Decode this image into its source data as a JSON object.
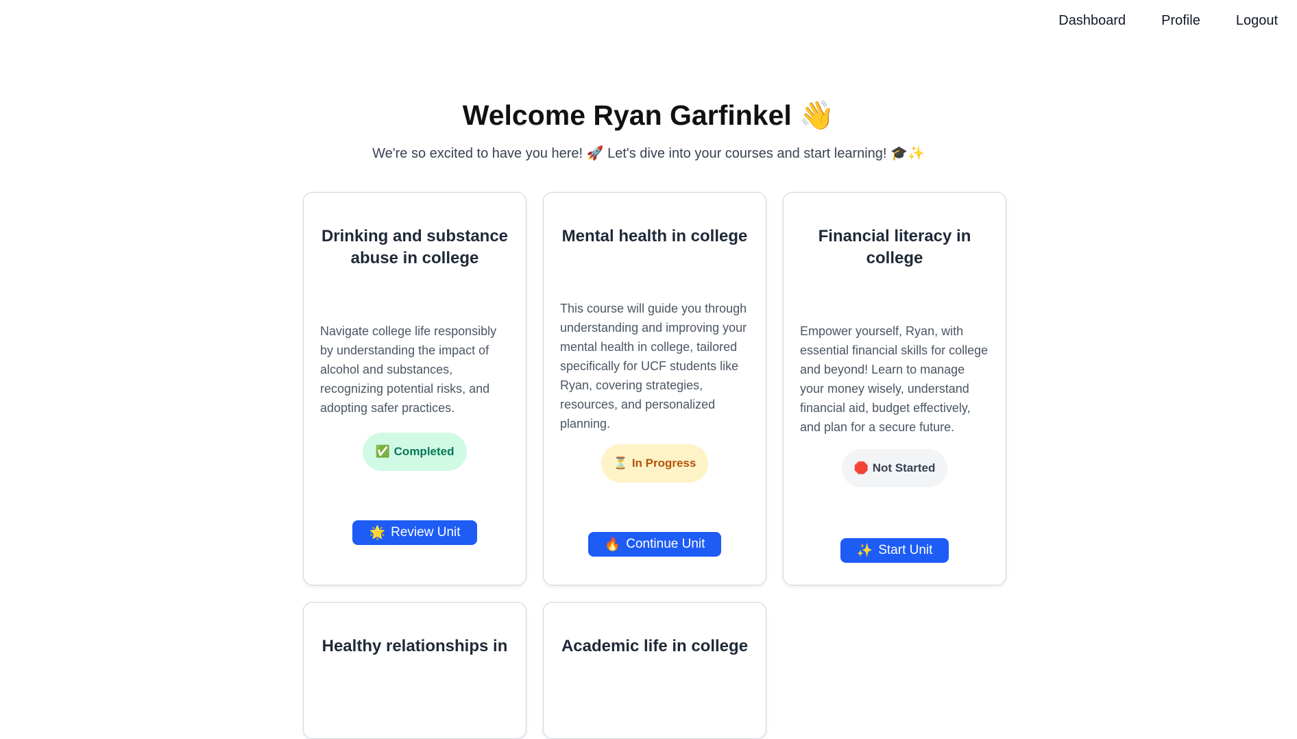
{
  "nav": {
    "dashboard": "Dashboard",
    "profile": "Profile",
    "logout": "Logout"
  },
  "hero": {
    "title": "Welcome Ryan Garfinkel 👋",
    "subtitle": "We're so excited to have you here! 🚀 Let's dive into your courses and start learning! 🎓✨"
  },
  "courses": [
    {
      "title": "Drinking and substance abuse in college",
      "description": "Navigate college life responsibly by understanding the impact of alcohol and substances, recognizing potential risks, and adopting safer practices.",
      "status_icon": "✅",
      "status": "Completed",
      "button_icon": "🌟",
      "button": "Review Unit"
    },
    {
      "title": "Mental health in college",
      "description": "This course will guide you through understanding and improving your mental health in college, tailored specifically for UCF students like Ryan, covering strategies, resources, and personalized planning.",
      "status_icon": "⏳",
      "status": "In Progress",
      "button_icon": "🔥",
      "button": "Continue Unit"
    },
    {
      "title": "Financial literacy in college",
      "description": "Empower yourself, Ryan, with essential financial skills for college and beyond! Learn to manage your money wisely, understand financial aid, budget effectively, and plan for a secure future.",
      "status_icon": "🛑",
      "status": "Not Started",
      "button_icon": "✨",
      "button": "Start Unit"
    },
    {
      "title": "Healthy relationships in"
    },
    {
      "title": "Academic life in college"
    }
  ],
  "colors": {
    "primary_button": "#1d5cf5",
    "completed_bg": "#d1fae5",
    "completed_text": "#047857",
    "progress_bg": "#fef3c7",
    "progress_text": "#b45309",
    "notstarted_bg": "#f3f4f6",
    "notstarted_text": "#374151"
  }
}
